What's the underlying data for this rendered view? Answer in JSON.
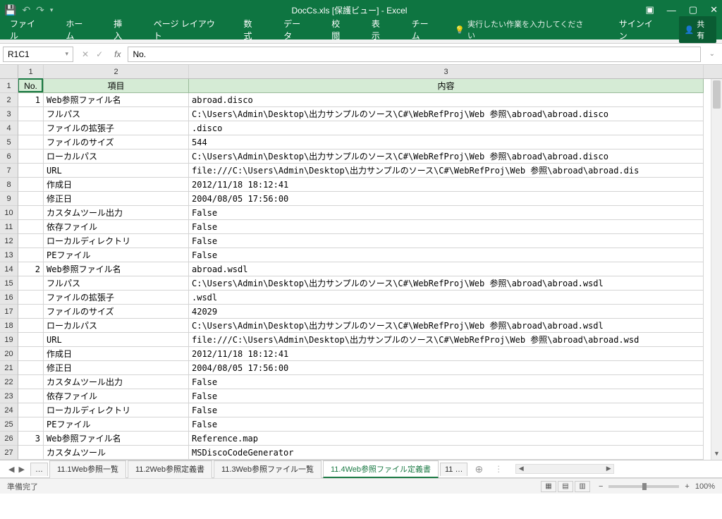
{
  "title": "DocCs.xls  [保護ビュー] - Excel",
  "ribbon": [
    "ファイル",
    "ホーム",
    "挿入",
    "ページ レイアウト",
    "数式",
    "データ",
    "校閲",
    "表示",
    "チーム"
  ],
  "tell_me": "実行したい作業を入力してください",
  "signin": "サインイン",
  "share": "共有",
  "namebox": "R1C1",
  "formula": "No.",
  "colhdrs": [
    "1",
    "2",
    "3"
  ],
  "headers": {
    "c1": "No.",
    "c2": "項目",
    "c3": "内容"
  },
  "rows": [
    {
      "n": "1",
      "no": "1",
      "k": "Web参照ファイル名",
      "v": "abroad.disco"
    },
    {
      "n": "2",
      "no": "",
      "k": "フルパス",
      "v": "C:\\Users\\Admin\\Desktop\\出力サンプルのソース\\C#\\WebRefProj\\Web 参照\\abroad\\abroad.disco"
    },
    {
      "n": "3",
      "no": "",
      "k": "ファイルの拡張子",
      "v": ".disco"
    },
    {
      "n": "4",
      "no": "",
      "k": "ファイルのサイズ",
      "v": "544"
    },
    {
      "n": "5",
      "no": "",
      "k": "ローカルパス",
      "v": "C:\\Users\\Admin\\Desktop\\出力サンプルのソース\\C#\\WebRefProj\\Web 参照\\abroad\\abroad.disco"
    },
    {
      "n": "6",
      "no": "",
      "k": "URL",
      "v": "file:///C:\\Users\\Admin\\Desktop\\出力サンプルのソース\\C#\\WebRefProj\\Web 参照\\abroad\\abroad.dis"
    },
    {
      "n": "7",
      "no": "",
      "k": "作成日",
      "v": "2012/11/18 18:12:41"
    },
    {
      "n": "8",
      "no": "",
      "k": "修正日",
      "v": "2004/08/05 17:56:00"
    },
    {
      "n": "9",
      "no": "",
      "k": "カスタムツール出力",
      "v": "False"
    },
    {
      "n": "10",
      "no": "",
      "k": "依存ファイル",
      "v": "False"
    },
    {
      "n": "11",
      "no": "",
      "k": "ローカルディレクトリ",
      "v": "False"
    },
    {
      "n": "12",
      "no": "",
      "k": "PEファイル",
      "v": "False"
    },
    {
      "n": "13",
      "no": "2",
      "k": "Web参照ファイル名",
      "v": "abroad.wsdl"
    },
    {
      "n": "14",
      "no": "",
      "k": "フルパス",
      "v": "C:\\Users\\Admin\\Desktop\\出力サンプルのソース\\C#\\WebRefProj\\Web 参照\\abroad\\abroad.wsdl"
    },
    {
      "n": "15",
      "no": "",
      "k": "ファイルの拡張子",
      "v": ".wsdl"
    },
    {
      "n": "16",
      "no": "",
      "k": "ファイルのサイズ",
      "v": "42029"
    },
    {
      "n": "17",
      "no": "",
      "k": "ローカルパス",
      "v": "C:\\Users\\Admin\\Desktop\\出力サンプルのソース\\C#\\WebRefProj\\Web 参照\\abroad\\abroad.wsdl"
    },
    {
      "n": "18",
      "no": "",
      "k": "URL",
      "v": "file:///C:\\Users\\Admin\\Desktop\\出力サンプルのソース\\C#\\WebRefProj\\Web 参照\\abroad\\abroad.wsd"
    },
    {
      "n": "19",
      "no": "",
      "k": "作成日",
      "v": "2012/11/18 18:12:41"
    },
    {
      "n": "20",
      "no": "",
      "k": "修正日",
      "v": "2004/08/05 17:56:00"
    },
    {
      "n": "21",
      "no": "",
      "k": "カスタムツール出力",
      "v": "False"
    },
    {
      "n": "22",
      "no": "",
      "k": "依存ファイル",
      "v": "False"
    },
    {
      "n": "23",
      "no": "",
      "k": "ローカルディレクトリ",
      "v": "False"
    },
    {
      "n": "24",
      "no": "",
      "k": "PEファイル",
      "v": "False"
    },
    {
      "n": "25",
      "no": "3",
      "k": "Web参照ファイル名",
      "v": "Reference.map"
    },
    {
      "n": "26",
      "no": "",
      "k": "カスタムツール",
      "v": "MSDiscoCodeGenerator"
    }
  ],
  "sheets": {
    "trunc_left": "…",
    "tabs": [
      "11.1Web参照一覧",
      "11.2Web参照定義書",
      "11.3Web参照ファイル一覧",
      "11.4Web参照ファイル定義書"
    ],
    "active": 3,
    "trunc_right": "11 …"
  },
  "status": "準備完了",
  "zoom": "100%"
}
